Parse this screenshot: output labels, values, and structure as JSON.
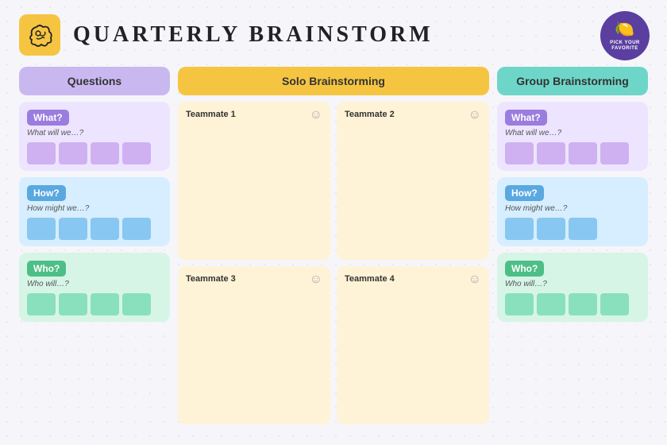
{
  "header": {
    "title": "QUARTERLY BRAINSTORM",
    "logo_alt": "brain-scribble",
    "badge_text": "PICK YOUR FAVORITE",
    "badge_emoji": "🍋"
  },
  "columns": {
    "questions": {
      "label": "Questions",
      "sections": [
        {
          "id": "what",
          "label": "What?",
          "subtitle": "What will we…?",
          "color": "purple",
          "sticky_count": 4
        },
        {
          "id": "how",
          "label": "How?",
          "subtitle": "How might we…?",
          "color": "blue",
          "sticky_count": 4
        },
        {
          "id": "who",
          "label": "Who?",
          "subtitle": "Who will…?",
          "color": "green",
          "sticky_count": 4
        }
      ]
    },
    "solo": {
      "label": "Solo Brainstorming",
      "teammates": [
        {
          "id": "t1",
          "name": "Teammate 1"
        },
        {
          "id": "t2",
          "name": "Teammate 2"
        },
        {
          "id": "t3",
          "name": "Teammate 3"
        },
        {
          "id": "t4",
          "name": "Teammate 4"
        }
      ]
    },
    "group": {
      "label": "Group Brainstorming",
      "sections": [
        {
          "id": "g_what",
          "label": "What?",
          "subtitle": "What will we…?",
          "color": "purple",
          "sticky_count": 4
        },
        {
          "id": "g_how",
          "label": "How?",
          "subtitle": "How might we…?",
          "color": "blue",
          "sticky_count": 3
        },
        {
          "id": "g_who",
          "label": "Who?",
          "subtitle": "Who will…?",
          "color": "green",
          "sticky_count": 4
        }
      ]
    }
  }
}
